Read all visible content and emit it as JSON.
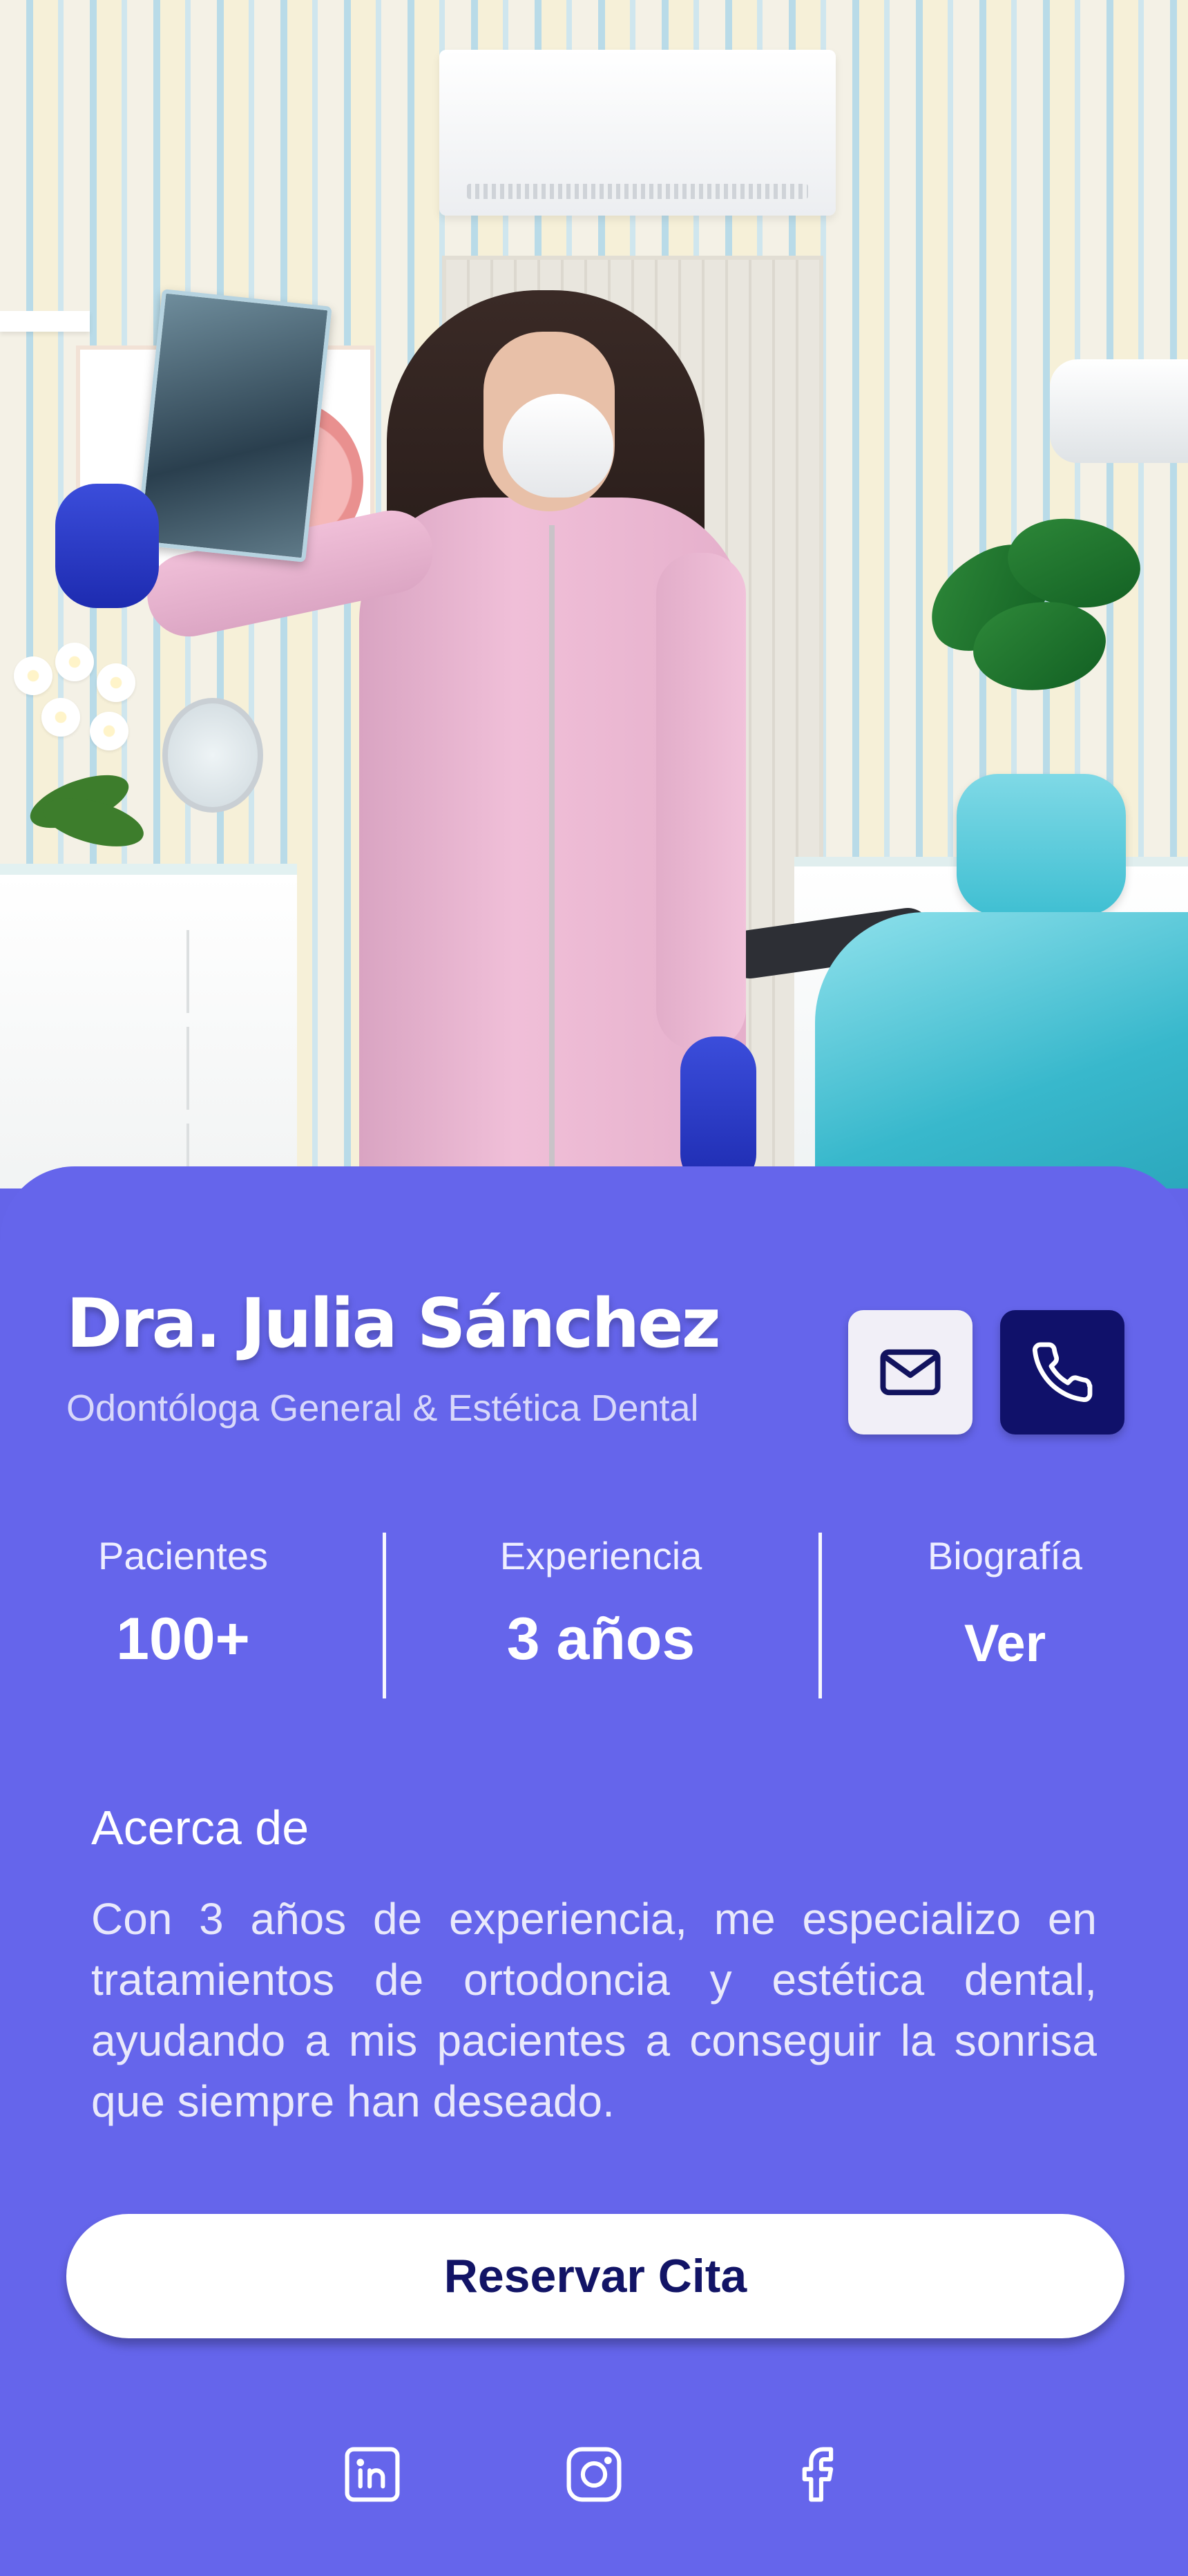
{
  "doctor": {
    "name": "Dra. Julia Sánchez",
    "specialty": "Odontóloga General & Estética Dental"
  },
  "contact": {
    "email_icon": "mail-icon",
    "phone_icon": "phone-icon"
  },
  "stats": [
    {
      "label": "Pacientes",
      "value": "100+"
    },
    {
      "label": "Experiencia",
      "value": "3 años"
    },
    {
      "label": "Biografía",
      "value": "Ver"
    }
  ],
  "about": {
    "title": "Acerca de",
    "text": "Con 3 años de experiencia, me especializo en tratamientos de ortodoncia y estética dental, ayudando a mis pacientes a conseguir la sonrisa que siempre han deseado."
  },
  "actions": {
    "book_label": "Reservar Cita"
  },
  "social": [
    {
      "icon": "linkedin-icon"
    },
    {
      "icon": "instagram-icon"
    },
    {
      "icon": "facebook-icon"
    }
  ],
  "colors": {
    "card_background": "#6565EB",
    "primary_dark": "#10116A",
    "email_button": "#F1EFF7",
    "text_white": "#FFFFFF"
  }
}
